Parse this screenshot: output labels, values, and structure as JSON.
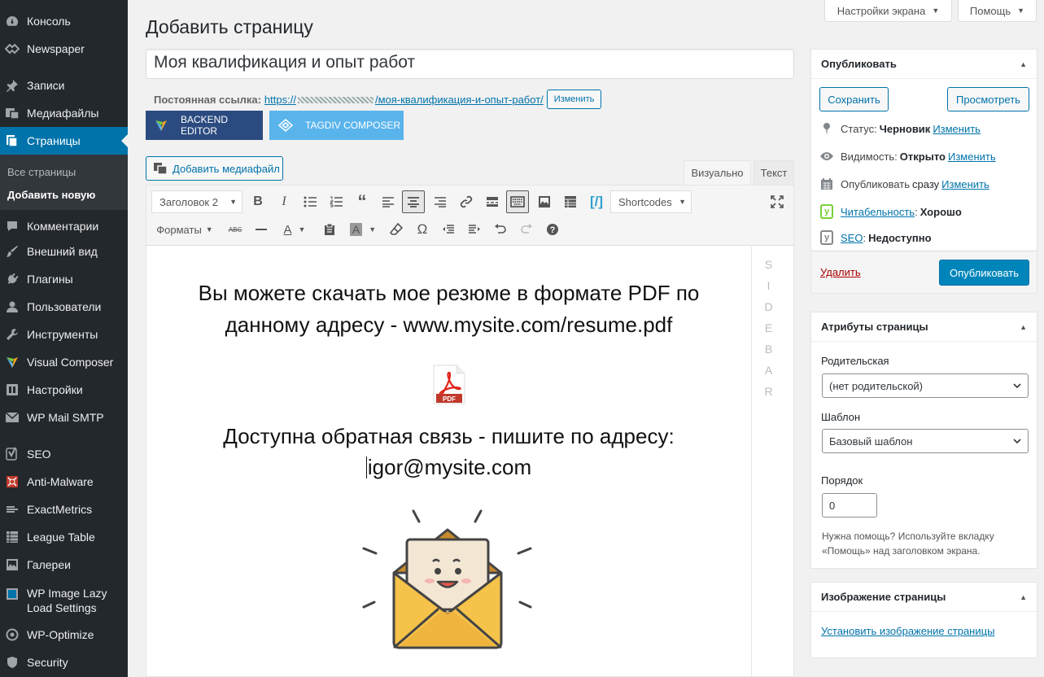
{
  "sidebar": {
    "items": [
      {
        "label": "Консоль",
        "icon": "dashboard-icon"
      },
      {
        "label": "Newspaper",
        "icon": "newspaper-icon"
      },
      {
        "label": "Записи",
        "icon": "pin-icon"
      },
      {
        "label": "Медиафайлы",
        "icon": "media-icon"
      },
      {
        "label": "Страницы",
        "icon": "pages-icon"
      },
      {
        "label": "Комментарии",
        "icon": "comments-icon"
      },
      {
        "label": "Внешний вид",
        "icon": "appearance-icon"
      },
      {
        "label": "Плагины",
        "icon": "plugins-icon"
      },
      {
        "label": "Пользователи",
        "icon": "users-icon"
      },
      {
        "label": "Инструменты",
        "icon": "tools-icon"
      },
      {
        "label": "Visual Composer",
        "icon": "visual-composer-icon"
      },
      {
        "label": "Настройки",
        "icon": "settings-icon"
      },
      {
        "label": "WP Mail SMTP",
        "icon": "mail-icon"
      },
      {
        "label": "SEO",
        "icon": "yoast-icon"
      },
      {
        "label": "Anti-Malware",
        "icon": "anti-malware-icon"
      },
      {
        "label": "ExactMetrics",
        "icon": "exactmetrics-icon"
      },
      {
        "label": "League Table",
        "icon": "table-icon"
      },
      {
        "label": "Галереи",
        "icon": "gallery-icon"
      },
      {
        "label": "WP Image Lazy Load Settings",
        "icon": "image-icon"
      },
      {
        "label": "WP-Optimize",
        "icon": "optimize-icon"
      },
      {
        "label": "Security",
        "icon": "security-icon"
      }
    ],
    "submenu": [
      "Все страницы",
      "Добавить новую"
    ]
  },
  "header": {
    "screen_options": "Настройки экрана",
    "help": "Помощь",
    "page_title": "Добавить страницу"
  },
  "post": {
    "title": "Моя квалификация и опыт работ",
    "permalink_label": "Постоянная ссылка:",
    "permalink_prefix": "https://",
    "permalink_slug": "/моя-квалификация-и-опыт-работ/",
    "change_button": "Изменить"
  },
  "composer": {
    "backend": "BACKEND EDITOR",
    "tagdiv": "TAGDIV COMPOSER"
  },
  "editor": {
    "add_media": "Добавить медиафайл",
    "tab_visual": "Визуально",
    "tab_text": "Текст",
    "format_select": "Заголовок 2",
    "shortcodes": "Shortcodes",
    "formats": "Форматы",
    "paragraph1_line1": "Вы можете скачать мое резюме в формате PDF  по",
    "paragraph1_line2": "данному адресу - www.mysite.com/resume.pdf",
    "paragraph2_line1": "Доступна обратная связь - пишите по адресу:",
    "paragraph2_line2": "igor@mysite.com",
    "pdf_label": "PDF",
    "sidebar_letters": [
      "S",
      "I",
      "D",
      "E",
      "B",
      "A",
      "R"
    ]
  },
  "publish": {
    "title": "Опубликовать",
    "save": "Сохранить",
    "preview": "Просмотреть",
    "status_label": "Статус:",
    "status_value": "Черновик",
    "visibility_label": "Видимость:",
    "visibility_value": "Открыто",
    "publish_label": "Опубликовать",
    "publish_value": "сразу",
    "edit_link": "Изменить",
    "readability_link": "Читабельность",
    "readability_value": "Хорошо",
    "seo_link": "SEO",
    "seo_value": "Недоступно",
    "delete": "Удалить",
    "publish_button": "Опубликовать"
  },
  "attributes": {
    "title": "Атрибуты страницы",
    "parent_label": "Родительская",
    "parent_value": "(нет родительской)",
    "template_label": "Шаблон",
    "template_value": "Базовый шаблон",
    "order_label": "Порядок",
    "order_value": "0",
    "help_text": "Нужна помощь? Используйте вкладку «Помощь» над заголовком экрана."
  },
  "featured": {
    "title": "Изображение страницы",
    "set_link": "Установить изображение страницы"
  },
  "colors": {
    "sidebar_bg": "#23282d",
    "active_blue": "#0073aa",
    "publish_blue": "#0085ba",
    "backend_btn": "#2b4b80",
    "tagdiv_btn": "#5ab4ec"
  }
}
